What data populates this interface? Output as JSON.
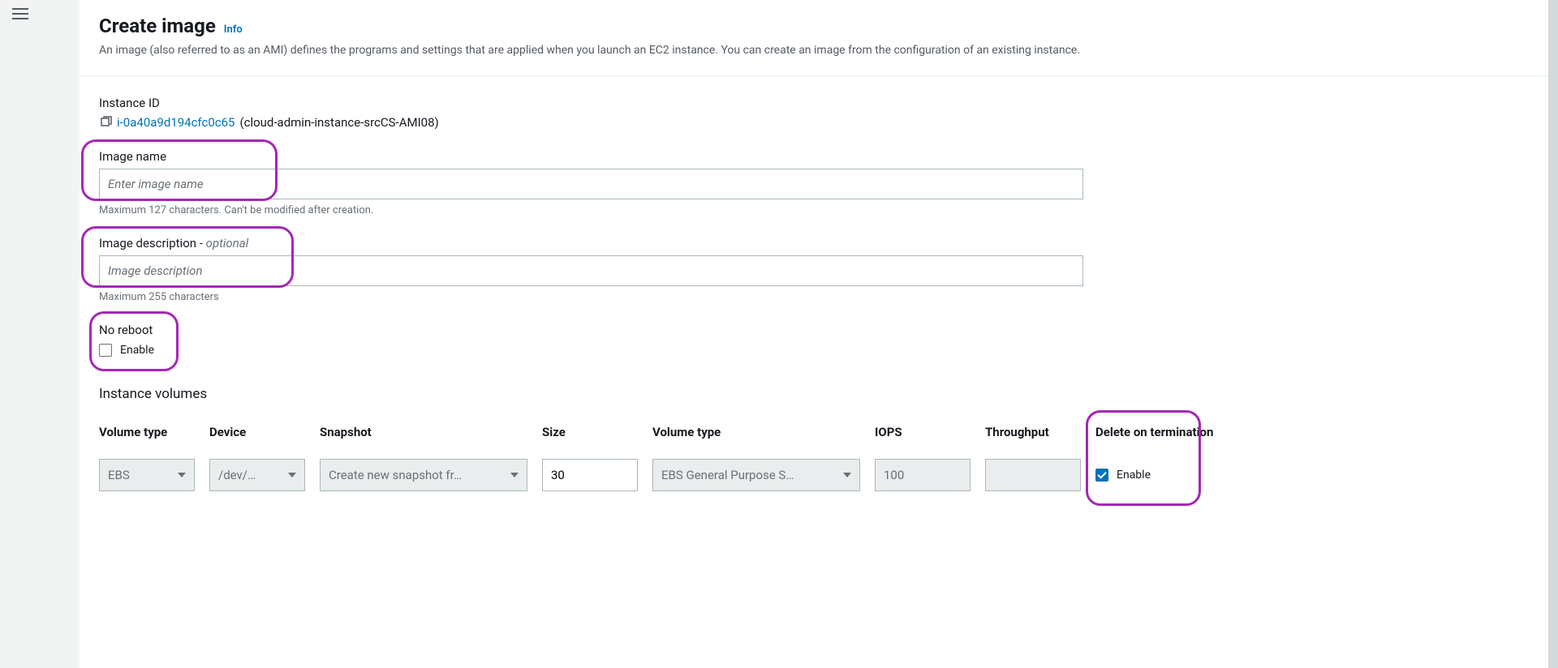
{
  "header": {
    "title": "Create image",
    "info_link": "Info",
    "subtitle": "An image (also referred to as an AMI) defines the programs and settings that are applied when you launch an EC2 instance. You can create an image from the configuration of an existing instance."
  },
  "instance": {
    "label": "Instance ID",
    "id": "i-0a40a9d194cfc0c65",
    "name_suffix": " (cloud-admin-instance-srcCS-AMI08)"
  },
  "image_name": {
    "label": "Image name",
    "placeholder": "Enter image name",
    "helper": "Maximum 127 characters. Can't be modified after creation."
  },
  "image_desc": {
    "label_prefix": "Image description - ",
    "label_optional": "optional",
    "placeholder": "Image description",
    "helper": "Maximum 255 characters"
  },
  "no_reboot": {
    "label": "No reboot",
    "checkbox_label": "Enable"
  },
  "volumes_section_title": "Instance volumes",
  "volumes": {
    "headers": {
      "vol_type1": "Volume type",
      "device": "Device",
      "snapshot": "Snapshot",
      "size": "Size",
      "vol_type2": "Volume type",
      "iops": "IOPS",
      "throughput": "Throughput",
      "delete_on_term": "Delete on termination"
    },
    "row": {
      "vol_type1": "EBS",
      "device": "/dev/…",
      "snapshot": "Create new snapshot fr…",
      "size": "30",
      "vol_type2": "EBS General Purpose S…",
      "iops": "100",
      "throughput": "",
      "delete_label": "Enable"
    }
  }
}
